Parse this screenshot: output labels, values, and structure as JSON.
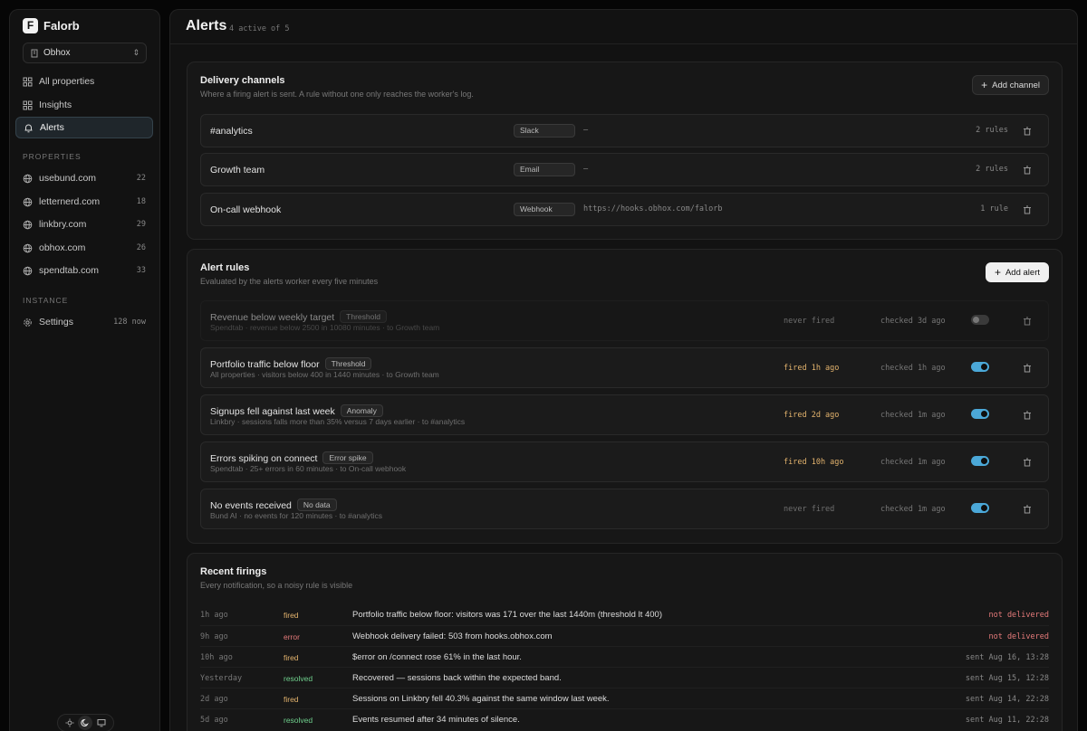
{
  "app": {
    "name": "Falorb",
    "logo_letter": "F",
    "workspace": "Obhox"
  },
  "nav": [
    {
      "label": "All properties",
      "icon": "grid-icon"
    },
    {
      "label": "Insights",
      "icon": "grid-icon"
    },
    {
      "label": "Alerts",
      "icon": "bell-icon",
      "active": true
    }
  ],
  "properties_label": "PROPERTIES",
  "properties": [
    {
      "label": "usebund.com",
      "count": "22"
    },
    {
      "label": "letternerd.com",
      "count": "18"
    },
    {
      "label": "linkbry.com",
      "count": "29"
    },
    {
      "label": "obhox.com",
      "count": "26"
    },
    {
      "label": "spendtab.com",
      "count": "33"
    }
  ],
  "instance_label": "INSTANCE",
  "settings": {
    "label": "Settings",
    "meta": "128 now"
  },
  "page": {
    "title": "Alerts",
    "subtitle": "4 active of 5"
  },
  "channels": {
    "title": "Delivery channels",
    "description": "Where a firing alert is sent. A rule without one only reaches the worker's log.",
    "add_label": "Add channel",
    "items": [
      {
        "name": "#analytics",
        "type": "Slack",
        "target": "—",
        "rules": "2 rules"
      },
      {
        "name": "Growth team",
        "type": "Email",
        "target": "—",
        "rules": "2 rules"
      },
      {
        "name": "On-call webhook",
        "type": "Webhook",
        "target": "https://hooks.obhox.com/falorb",
        "rules": "1 rule"
      }
    ]
  },
  "rules": {
    "title": "Alert rules",
    "description": "Evaluated by the alerts worker every five minutes",
    "add_label": "Add alert",
    "items": [
      {
        "name": "Revenue below weekly target",
        "kind": "Threshold",
        "meta": "Spendtab · revenue below 2500 in 10080 minutes · to Growth team",
        "fired": "never fired",
        "checked": "checked 3d ago",
        "enabled": false
      },
      {
        "name": "Portfolio traffic below floor",
        "kind": "Threshold",
        "meta": "All properties · visitors below 400 in 1440 minutes · to Growth team",
        "fired": "fired 1h ago",
        "checked": "checked 1h ago",
        "enabled": true
      },
      {
        "name": "Signups fell against last week",
        "kind": "Anomaly",
        "meta": "Linkbry · sessions falls more than 35% versus 7 days earlier · to #analytics",
        "fired": "fired 2d ago",
        "checked": "checked 1m ago",
        "enabled": true
      },
      {
        "name": "Errors spiking on connect",
        "kind": "Error spike",
        "meta": "Spendtab · 25+ errors in 60 minutes · to On-call webhook",
        "fired": "fired 10h ago",
        "checked": "checked 1m ago",
        "enabled": true
      },
      {
        "name": "No events received",
        "kind": "No data",
        "meta": "Bund AI · no events for 120 minutes · to #analytics",
        "fired": "never fired",
        "checked": "checked 1m ago",
        "enabled": true
      }
    ]
  },
  "firings": {
    "title": "Recent firings",
    "description": "Every notification, so a noisy rule is visible",
    "items": [
      {
        "when": "1h ago",
        "kind": "fired",
        "message": "Portfolio traffic below floor: visitors was 171 over the last 1440m (threshold lt 400)",
        "status": "not delivered"
      },
      {
        "when": "9h ago",
        "kind": "error",
        "message": "Webhook delivery failed: 503 from hooks.obhox.com",
        "status": "not delivered"
      },
      {
        "when": "10h ago",
        "kind": "fired",
        "message": "$error on /connect rose 61% in the last hour.",
        "status": "sent Aug 16, 13:28"
      },
      {
        "when": "Yesterday",
        "kind": "resolved",
        "message": "Recovered — sessions back within the expected band.",
        "status": "sent Aug 15, 12:28"
      },
      {
        "when": "2d ago",
        "kind": "fired",
        "message": "Sessions on Linkbry fell 40.3% against the same window last week.",
        "status": "sent Aug 14, 22:28"
      },
      {
        "when": "5d ago",
        "kind": "resolved",
        "message": "Events resumed after 34 minutes of silence.",
        "status": "sent Aug 11, 22:28"
      }
    ]
  },
  "colors": {
    "accent": "#4ba8d8",
    "warn": "#e3b36d",
    "error": "#e57a7a",
    "ok": "#6fcf8c"
  }
}
